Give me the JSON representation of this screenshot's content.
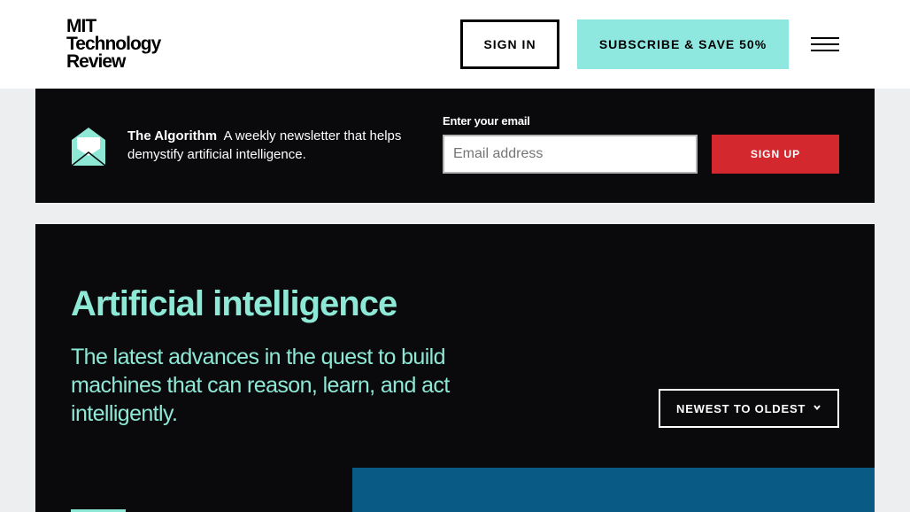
{
  "header": {
    "logo_lines": [
      "MIT",
      "Technology",
      "Review"
    ],
    "signin_label": "SIGN IN",
    "subscribe_label": "SUBSCRIBE & SAVE 50%",
    "menu_icon": "hamburger-menu-icon"
  },
  "newsletter": {
    "icon": "envelope-icon",
    "name": "The Algorithm",
    "description": "A weekly newsletter that helps demystify artificial intelligence.",
    "email_label": "Enter your email",
    "email_placeholder": "Email address",
    "email_value": "",
    "signup_label": "SIGN UP"
  },
  "topic": {
    "title": "Artificial intelligence",
    "description": "The latest advances in the quest to build machines that can reason, learn, and act intelligently.",
    "sort_label": "NEWEST TO OLDEST",
    "sort_icon": "chevron-down-icon"
  },
  "colors": {
    "accent_teal": "#8ee8e0",
    "signup_red": "#d3282d",
    "dark_bg": "#0a0a0d",
    "feature_blue": "#0a5a86"
  }
}
